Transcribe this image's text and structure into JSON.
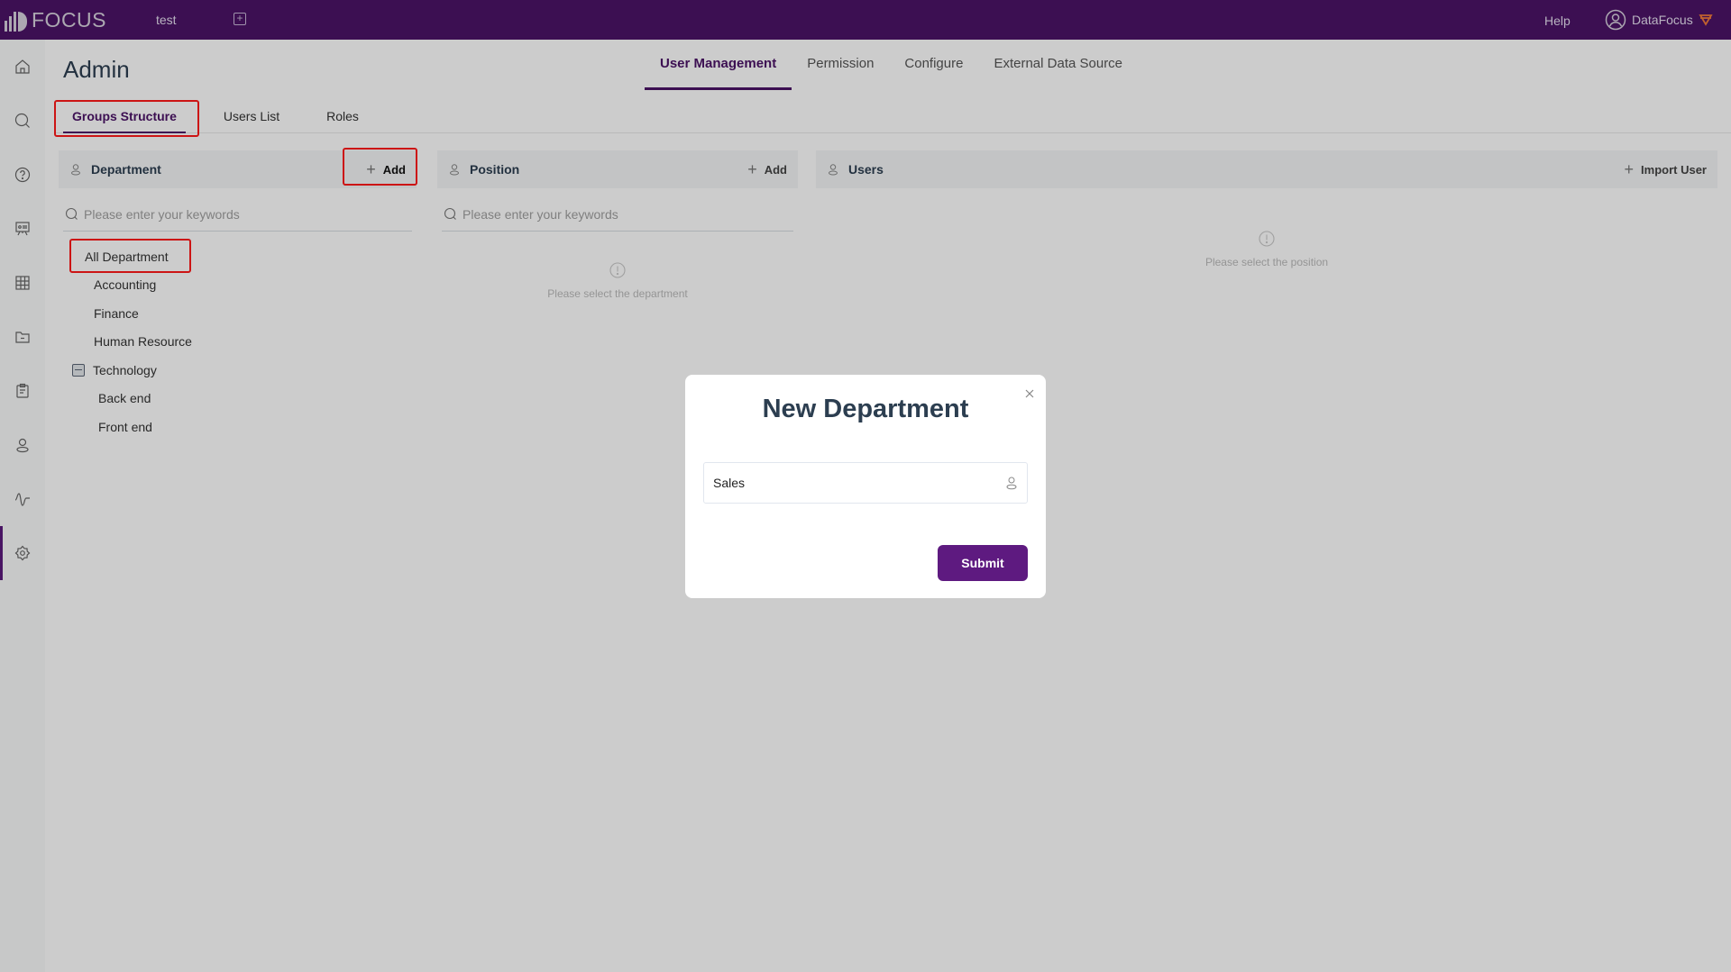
{
  "app": {
    "logo_text": "FOCUS",
    "current_tab": "test",
    "help_label": "Help",
    "user_name": "DataFocus",
    "brand_color": "#4b1367"
  },
  "sidebar": {
    "items": [
      {
        "icon": "home-icon"
      },
      {
        "icon": "search-icon"
      },
      {
        "icon": "question-icon"
      },
      {
        "icon": "presentation-icon"
      },
      {
        "icon": "table-grid-icon"
      },
      {
        "icon": "folder-icon"
      },
      {
        "icon": "clipboard-icon"
      },
      {
        "icon": "user-icon"
      },
      {
        "icon": "pulse-icon"
      },
      {
        "icon": "gear-icon",
        "active": true
      }
    ]
  },
  "page": {
    "title": "Admin",
    "main_tabs": [
      {
        "label": "User Management",
        "active": true
      },
      {
        "label": "Permission"
      },
      {
        "label": "Configure"
      },
      {
        "label": "External Data Source"
      }
    ],
    "sub_tabs": [
      {
        "label": "Groups Structure",
        "active": true
      },
      {
        "label": "Users List"
      },
      {
        "label": "Roles"
      }
    ]
  },
  "panels": {
    "department": {
      "title": "Department",
      "action_label": "Add",
      "search_placeholder": "Please enter your keywords",
      "tree": [
        {
          "label": "All Department",
          "level": 0
        },
        {
          "label": "Accounting",
          "level": 1
        },
        {
          "label": "Finance",
          "level": 1
        },
        {
          "label": "Human Resource",
          "level": 1
        },
        {
          "label": "Technology",
          "level": 1,
          "expanded": true
        },
        {
          "label": "Back end",
          "level": 2
        },
        {
          "label": "Front end",
          "level": 2
        }
      ]
    },
    "position": {
      "title": "Position",
      "action_label": "Add",
      "search_placeholder": "Please enter your keywords",
      "empty_text": "Please select the department"
    },
    "users": {
      "title": "Users",
      "action_label": "Import User",
      "empty_text": "Please select the position"
    }
  },
  "modal": {
    "title": "New Department",
    "input_value": "Sales",
    "submit_label": "Submit",
    "submit_color": "#5e1a80"
  }
}
